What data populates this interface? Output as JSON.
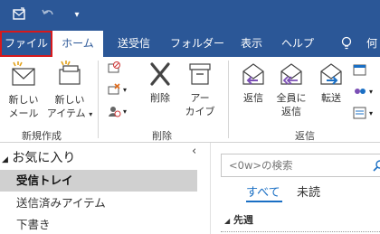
{
  "tabs": [
    {
      "label": "ファイル"
    },
    {
      "label": "ホーム"
    },
    {
      "label": "送受信"
    },
    {
      "label": "フォルダー"
    },
    {
      "label": "表示"
    },
    {
      "label": "ヘルプ"
    },
    {
      "label": "何"
    }
  ],
  "ribbon": {
    "new_mail": [
      "新しい",
      "メール"
    ],
    "new_items": [
      "新しい",
      "アイテム"
    ],
    "delete": "削除",
    "archive": [
      "アー",
      "カイブ"
    ],
    "reply": "返信",
    "reply_all": [
      "全員に",
      "返信"
    ],
    "forward": "転送",
    "groups": {
      "new": "新規作成",
      "delete": "削除",
      "respond": "返信"
    }
  },
  "folders": {
    "favorites_label": "お気に入り",
    "items": [
      {
        "label": "受信トレイ",
        "selected": true
      },
      {
        "label": "送信済みアイテム",
        "selected": false
      },
      {
        "label": "下書き",
        "selected": false
      }
    ]
  },
  "messages": {
    "search_placeholder": "<0w>の検索",
    "filters": [
      "すべて",
      "未読"
    ],
    "group_header": "先週"
  },
  "colors": {
    "accent": "#2b5797",
    "highlight_box": "#d7191c",
    "selected_folder": "#d0d0d0"
  }
}
